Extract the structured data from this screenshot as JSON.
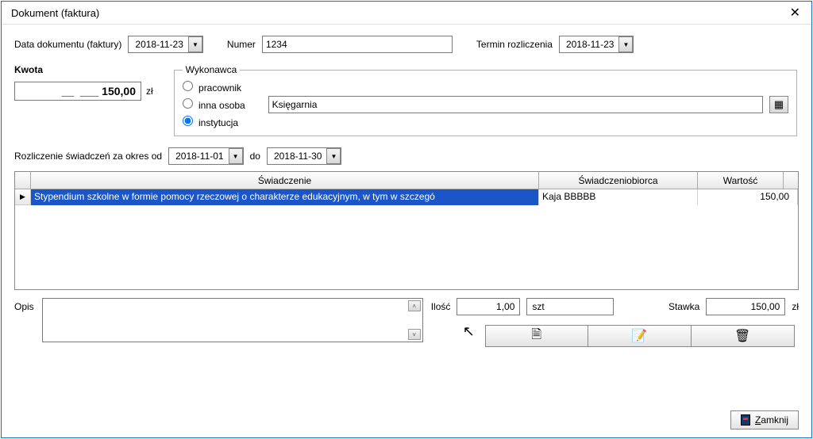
{
  "title": "Dokument (faktura)",
  "row1": {
    "data_dok_label": "Data dokumentu (faktury)",
    "data_dok_value": "2018-11-23",
    "numer_label": "Numer",
    "numer_value": "1234",
    "termin_label": "Termin rozliczenia",
    "termin_value": "2018-11-23"
  },
  "kwota": {
    "label": "Kwota",
    "value": "__  ___ 150,00",
    "currency": "zł"
  },
  "wykonawca": {
    "legend": "Wykonawca",
    "opt_pracownik": "pracownik",
    "opt_inna": "inna osoba",
    "opt_inst": "instytucja",
    "selected": "instytucja",
    "name_value": "Księgarnia"
  },
  "okres": {
    "label": "Rozliczenie świadczeń za okres od",
    "od_value": "2018-11-01",
    "do_label": "do",
    "do_value": "2018-11-30"
  },
  "grid": {
    "headers": {
      "swiadczenie": "Świadczenie",
      "biorca": "Świadczeniobiorca",
      "wartosc": "Wartość"
    },
    "rows": [
      {
        "swiadczenie": "Stypendium szkolne w formie pomocy rzeczowej o charakterze edukacyjnym, w tym w szczegó",
        "biorca": "Kaja BBBBB",
        "wartosc": "150,00"
      }
    ]
  },
  "detail": {
    "opis_label": "Opis",
    "opis_value": "",
    "ilosc_label": "Ilość",
    "ilosc_value": "1,00",
    "jednostka": "szt",
    "stawka_label": "Stawka",
    "stawka_value": "150,00",
    "stawka_unit": "zł"
  },
  "icons": {
    "new": "🗎",
    "edit": "📝",
    "delete": "🗑"
  },
  "footer": {
    "zamknij": "Zamknij"
  }
}
